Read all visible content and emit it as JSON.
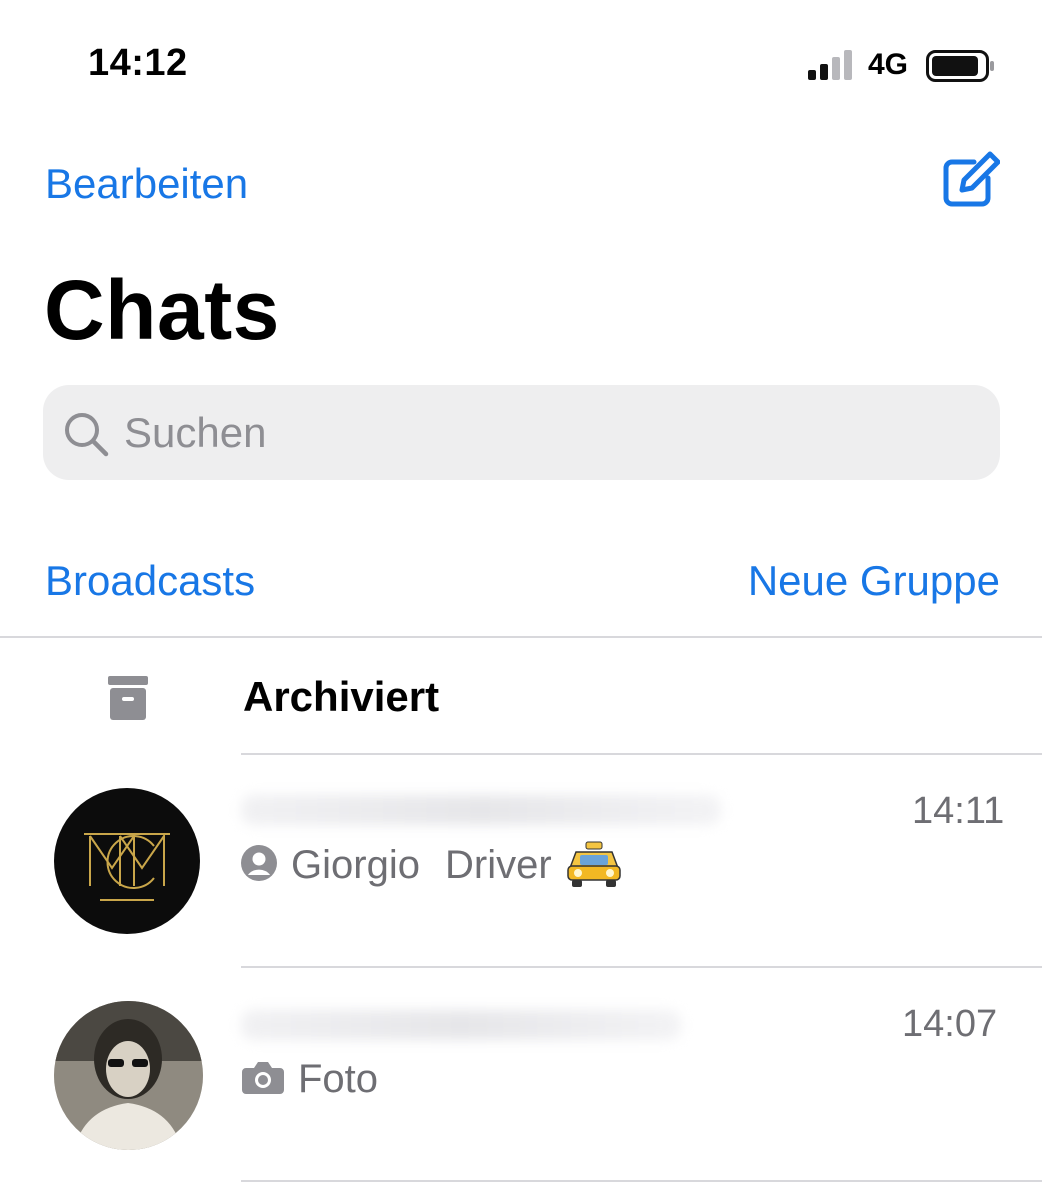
{
  "status_bar": {
    "time": "14:12",
    "network": "4G"
  },
  "nav": {
    "edit_label": "Bearbeiten"
  },
  "header": {
    "title": "Chats"
  },
  "search": {
    "placeholder": "Suchen"
  },
  "actions": {
    "broadcasts_label": "Broadcasts",
    "new_group_label": "Neue Gruppe"
  },
  "archive": {
    "label": "Archiviert"
  },
  "chats": [
    {
      "time": "14:11",
      "sender": "Giorgio",
      "preview": "Driver"
    },
    {
      "time": "14:07",
      "preview": "Foto"
    }
  ],
  "colors": {
    "accent": "#1877e6",
    "secondary_text": "#6e6e73",
    "search_bg": "#eeeeef"
  },
  "icons": [
    "signal-icon",
    "battery-icon",
    "compose-icon",
    "search-icon",
    "archive-icon",
    "person-icon",
    "camera-icon",
    "taxi-emoji-icon"
  ]
}
